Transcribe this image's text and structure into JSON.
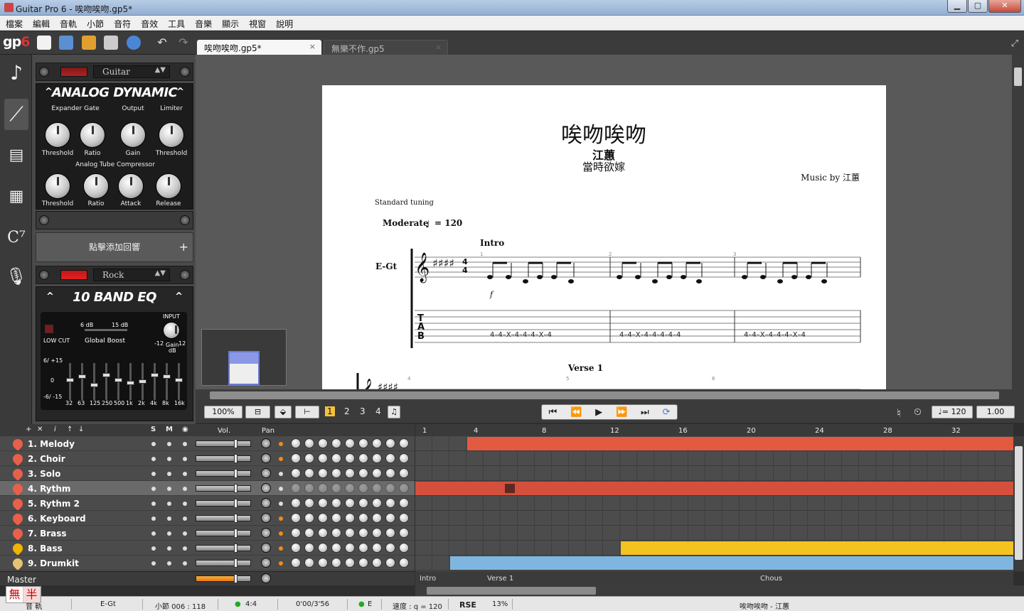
{
  "window": {
    "title": "Guitar Pro 6 - 唉吻唉吻.gp5*",
    "minimize": "▁",
    "maximize": "▢",
    "close": "✕"
  },
  "menu": [
    "檔案",
    "編輯",
    "音軌",
    "小節",
    "音符",
    "音效",
    "工具",
    "音樂",
    "顯示",
    "視窗",
    "說明"
  ],
  "logo": {
    "text": "gp",
    "num": "6"
  },
  "tabs": [
    {
      "label": "唉吻唉吻.gp5*",
      "close": "×"
    },
    {
      "label": "無樂不作.gp5",
      "close": "×"
    }
  ],
  "rack": {
    "preset1": "Guitar",
    "dynamic": {
      "title": "ANALOG DYNAMIC",
      "sections": [
        "Expander Gate",
        "Output",
        "Limiter"
      ],
      "knobs1": [
        "Threshold",
        "Ratio",
        "Gain",
        "Threshold"
      ],
      "compressor": "Analog Tube Compressor",
      "knobs2": [
        "Threshold",
        "Ratio",
        "Attack",
        "Release"
      ]
    },
    "add_effect": "點擊添加回響",
    "add_plus": "+",
    "preset2": "Rock",
    "eq": {
      "title": "10 BAND EQ",
      "input": "INPUT",
      "lowcut": "LOW CUT",
      "global_boost": "Global Boost",
      "db6": "6 dB",
      "db15": "15 dB",
      "scale_top": "6/ +15",
      "scale_mid": "0",
      "scale_bot": "-6/ -15",
      "gain_label": "Gain",
      "gain_unit": "dB",
      "gain_min": "-12",
      "gain_max": "12",
      "freqs": [
        "32",
        "63",
        "125",
        "250",
        "500",
        "1k",
        "2k",
        "4k",
        "8k",
        "16k"
      ],
      "levels": [
        0.45,
        0.35,
        0.6,
        0.3,
        0.45,
        0.55,
        0.5,
        0.3,
        0.35,
        0.45
      ]
    }
  },
  "score": {
    "title": "唉吻唉吻",
    "artist": "江蕙",
    "album": "當時欲嫁",
    "music_by": "Music by 江蕙",
    "tuning": "Standard tuning",
    "tempo_label": "Moderate",
    "tempo_value": "= 120",
    "section1": "Intro",
    "section2": "Verse 1",
    "track": "E-Gt",
    "dynamic": "f",
    "bar_numbers": [
      "1",
      "2",
      "3",
      "4",
      "5",
      "6"
    ],
    "tab_strings": "T A B",
    "tab_line": "4–4–X–4–4–4–X–4",
    "tab_line2": "4–4–X–4–4–4–4–4"
  },
  "controls": {
    "zoom": "100%",
    "pages": [
      "1",
      "2",
      "3",
      "4"
    ],
    "tempo": "♩= 120",
    "speed": "1.00"
  },
  "track_header": {
    "s": "S",
    "m": "M",
    "vol": "Vol.",
    "pan": "Pan"
  },
  "tracks": [
    {
      "name": "1. Melody",
      "color": "#e8604a"
    },
    {
      "name": "2. Choir",
      "color": "#e8604a"
    },
    {
      "name": "3. Solo",
      "color": "#e8604a"
    },
    {
      "name": "4. Rythm",
      "color": "#e8604a"
    },
    {
      "name": "5. Rythm 2",
      "color": "#e8604a"
    },
    {
      "name": "6. Keyboard",
      "color": "#e8604a"
    },
    {
      "name": "7. Brass",
      "color": "#e8604a"
    },
    {
      "name": "8. Bass",
      "color": "#f0b400"
    },
    {
      "name": "9. Drumkit",
      "color": "#e6c277"
    }
  ],
  "master": "Master",
  "timeline": {
    "bars": [
      "1",
      "4",
      "8",
      "12",
      "16",
      "20",
      "24",
      "28",
      "32"
    ],
    "sections": [
      "Intro",
      "Verse 1",
      "Chous"
    ]
  },
  "status": {
    "a": "音 軌",
    "track": "E-Gt",
    "bar": "小節 006 : 118",
    "sig": "4:4",
    "time": "0'00/3'56",
    "key": "E",
    "speed": "速度 : q = 120",
    "rse": "RSE",
    "cpu": "13%",
    "song": "唉吻唉吻 - 江蕙"
  },
  "ime": [
    "無",
    "半"
  ]
}
